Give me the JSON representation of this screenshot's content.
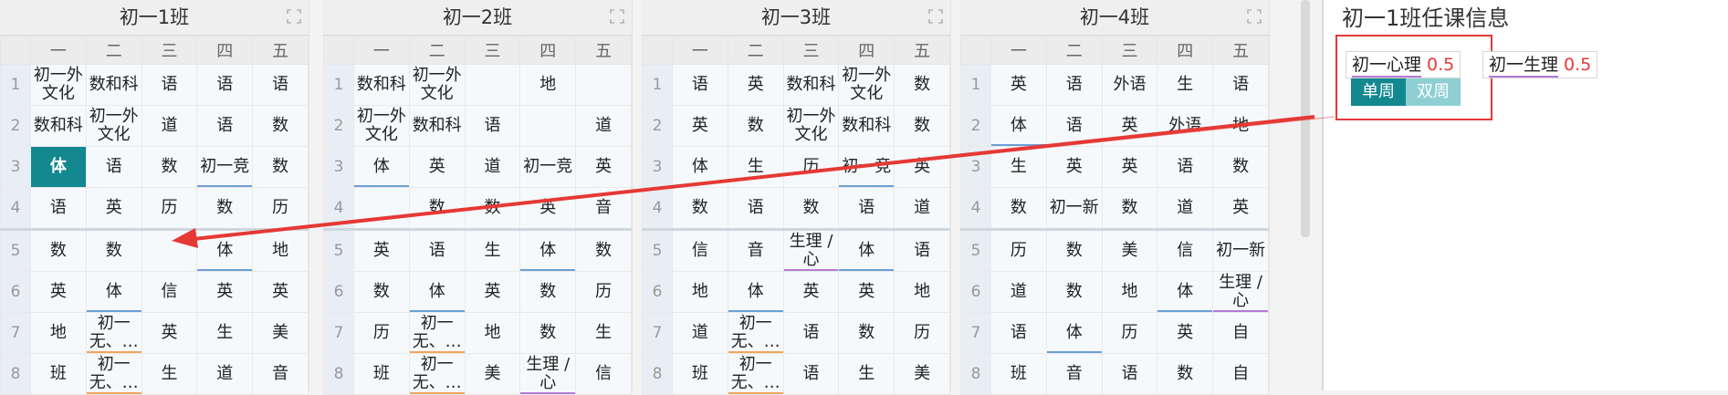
{
  "day_headers": [
    "一",
    "二",
    "三",
    "四",
    "五"
  ],
  "row_numbers": [
    "1",
    "2",
    "3",
    "4",
    "5",
    "6",
    "7",
    "8"
  ],
  "classes": [
    {
      "title": "初一1班",
      "rows": [
        [
          "初一外文化",
          "数和科",
          "语",
          "语",
          "语"
        ],
        [
          "数和科",
          "初一外文化",
          "道",
          "语",
          "数"
        ],
        [
          "体",
          "语",
          "数",
          "初一竞",
          "数"
        ],
        [
          "语",
          "英",
          "历",
          "数",
          "历"
        ],
        [
          "数",
          "数",
          "",
          "体",
          "地"
        ],
        [
          "英",
          "体",
          "信",
          "英",
          "英"
        ],
        [
          "地",
          "初一无、…",
          "英",
          "生",
          "美"
        ],
        [
          "班",
          "初一无、…",
          "生",
          "道",
          "音"
        ]
      ]
    },
    {
      "title": "初一2班",
      "rows": [
        [
          "数和科",
          "初一外文化",
          "",
          "地",
          ""
        ],
        [
          "初一外文化",
          "数和科",
          "语",
          "",
          "道"
        ],
        [
          "体",
          "英",
          "道",
          "初一竞",
          "英"
        ],
        [
          "",
          "数",
          "数",
          "英",
          "音"
        ],
        [
          "英",
          "语",
          "生",
          "体",
          "数"
        ],
        [
          "数",
          "体",
          "英",
          "数",
          "历"
        ],
        [
          "历",
          "初一无、…",
          "地",
          "数",
          "生"
        ],
        [
          "班",
          "初一无、…",
          "美",
          "生理 / 心",
          "信"
        ]
      ]
    },
    {
      "title": "初一3班",
      "rows": [
        [
          "语",
          "英",
          "数和科",
          "初一外文化",
          "数"
        ],
        [
          "英",
          "数",
          "初一外文化",
          "数和科",
          "数"
        ],
        [
          "体",
          "生",
          "历",
          "初一竞",
          "英"
        ],
        [
          "数",
          "语",
          "数",
          "语",
          "道"
        ],
        [
          "信",
          "音",
          "生理 / 心",
          "体",
          "语"
        ],
        [
          "地",
          "体",
          "英",
          "英",
          "地"
        ],
        [
          "道",
          "初一无、…",
          "语",
          "数",
          "历"
        ],
        [
          "班",
          "初一无、…",
          "语",
          "生",
          "美"
        ]
      ]
    },
    {
      "title": "初一4班",
      "rows": [
        [
          "英",
          "语",
          "外语",
          "生",
          "语"
        ],
        [
          "体",
          "语",
          "英",
          "外语",
          "地"
        ],
        [
          "生",
          "英",
          "英",
          "语",
          "数"
        ],
        [
          "数",
          "初一新",
          "数",
          "道",
          "英"
        ],
        [
          "历",
          "数",
          "美",
          "信",
          "初一新"
        ],
        [
          "道",
          "数",
          "地",
          "体",
          "生理 / 心"
        ],
        [
          "语",
          "体",
          "历",
          "英",
          "自"
        ],
        [
          "班",
          "音",
          "语",
          "数",
          "自"
        ]
      ]
    }
  ],
  "info": {
    "title": "初一1班任课信息",
    "courses": [
      {
        "name": "初一心理",
        "hours": "0.5"
      },
      {
        "name": "初一生理",
        "hours": "0.5"
      }
    ],
    "toggle": {
      "single": "单周",
      "double": "双周"
    }
  }
}
